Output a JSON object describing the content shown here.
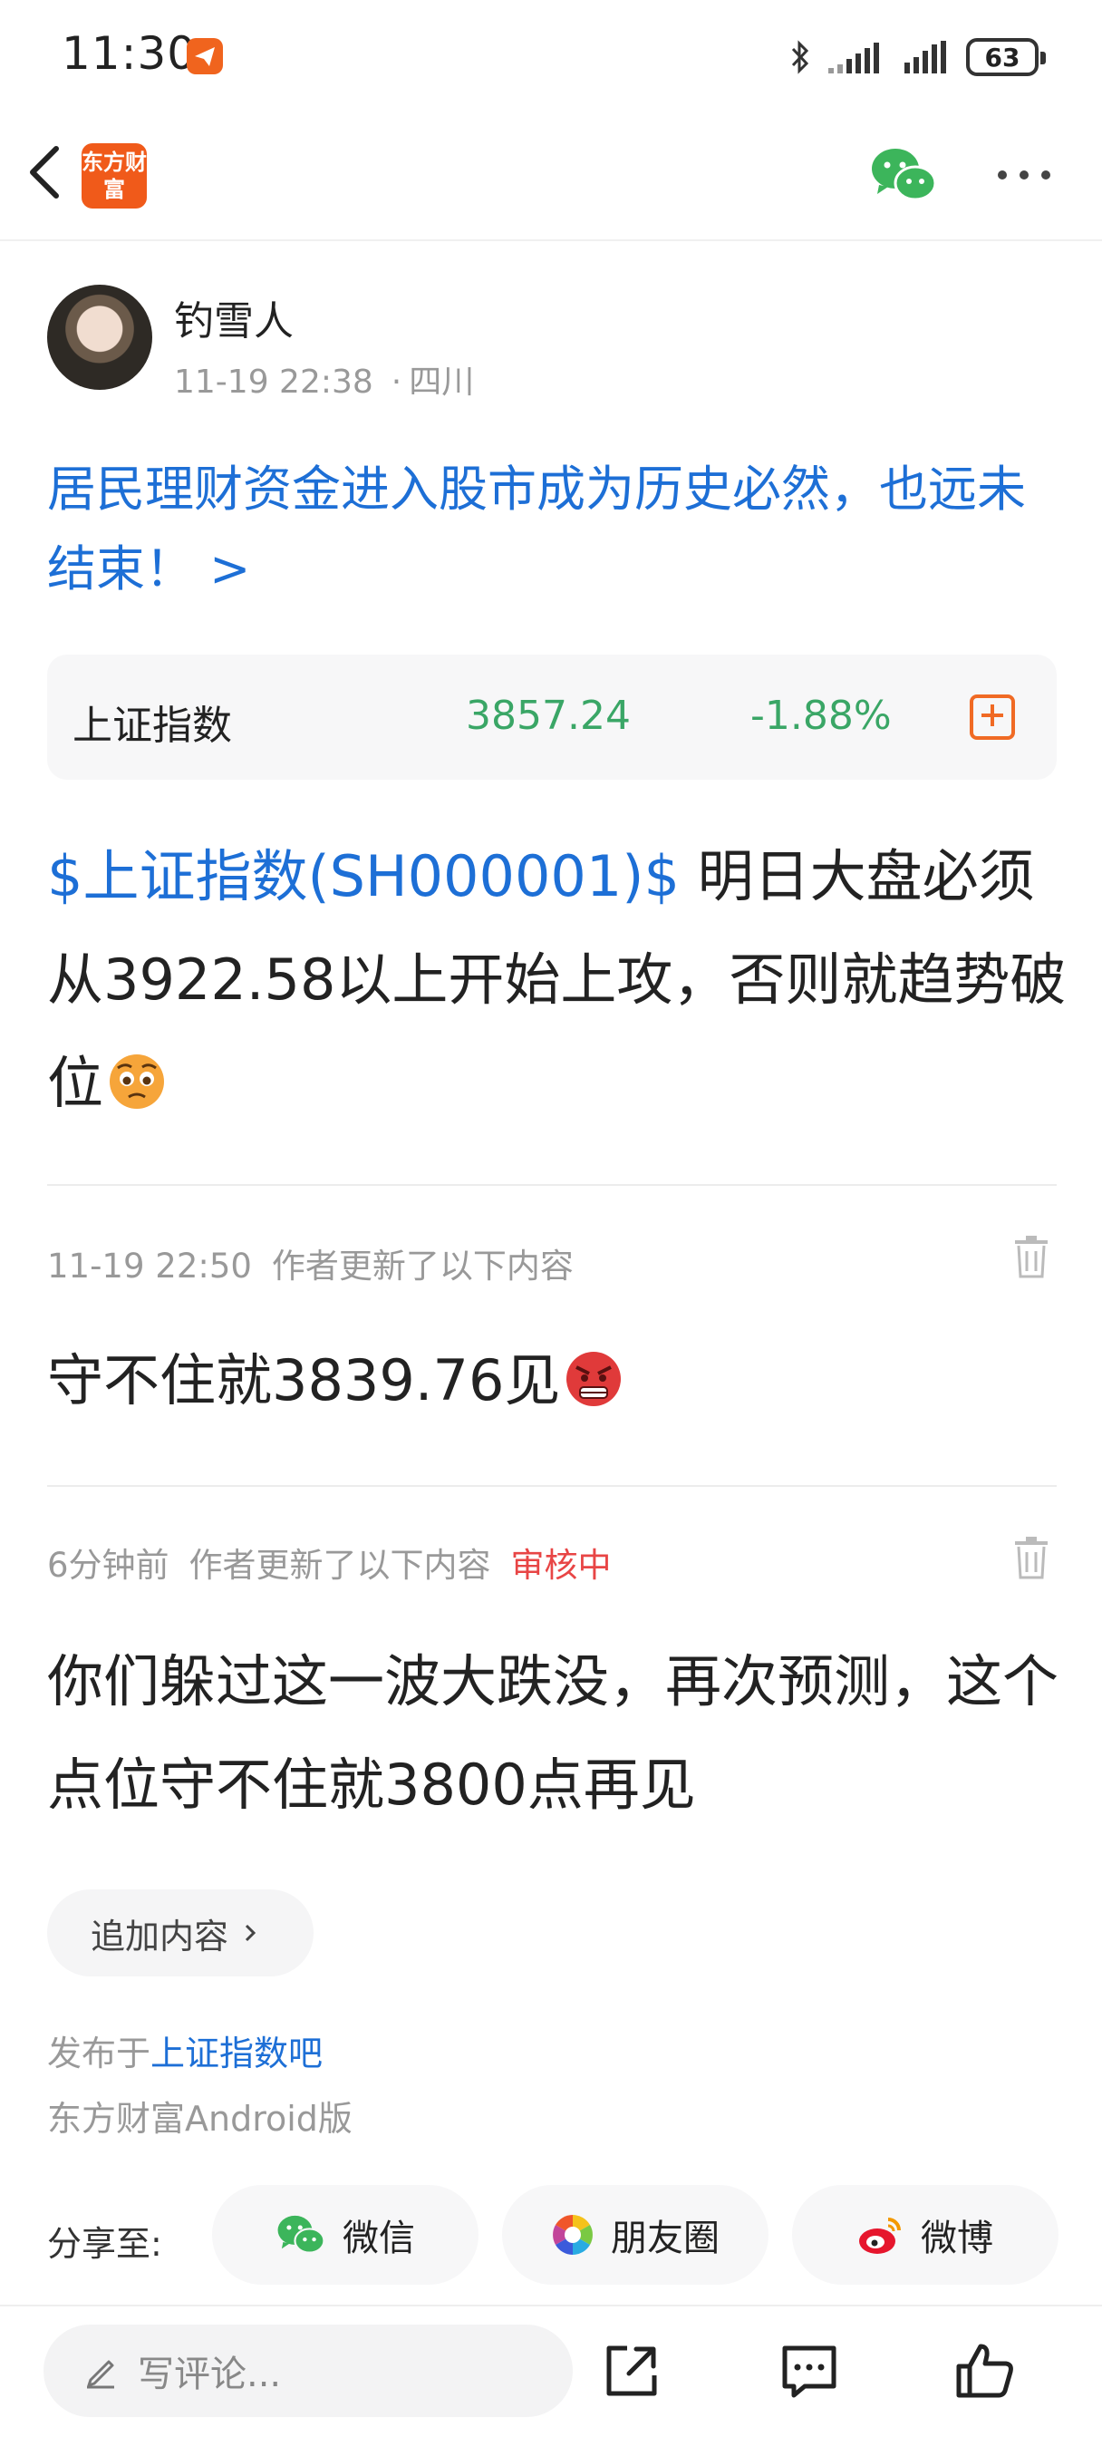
{
  "status_bar": {
    "time": "11:30",
    "battery": "63"
  },
  "app_bar": {
    "brand_logo_text": "东方财富"
  },
  "author": {
    "name": "钓雪人",
    "datetime": "11-19 22:38",
    "location": "四川",
    "separator": "·"
  },
  "post": {
    "title": "居民理财资金进入股市成为历史必然，也远未结束！ >",
    "quote": {
      "name": "上证指数",
      "price": "3857.24",
      "change": "-1.88%"
    },
    "stock_tag": "$上证指数(SH000001)$",
    "body": " 明日大盘必须从3922.58以上开始上攻，否则就趋势破位"
  },
  "updates": [
    {
      "time": "11-19 22:50",
      "label": "作者更新了以下内容",
      "status": "",
      "text": "守不住就3839.76见"
    },
    {
      "time": "6分钟前",
      "label": "作者更新了以下内容",
      "status": "审核中",
      "text": "你们躲过这一波大跌没，再次预测，这个点位守不住就3800点再见"
    }
  ],
  "append_button": "追加内容",
  "published": {
    "prefix": "发布于",
    "forum": "上证指数吧"
  },
  "platform": "东方财富Android版",
  "share": {
    "label": "分享至:",
    "wechat": "微信",
    "moments": "朋友圈",
    "weibo": "微博"
  },
  "bottom_bar": {
    "comment_placeholder": "写评论..."
  },
  "colors": {
    "link_blue": "#1d6fd6",
    "down_green": "#3aa666",
    "accent_orange": "#f06a24",
    "review_red": "#e84545"
  },
  "icons": [
    "back-arrow-icon",
    "wechat-icon",
    "more-icon",
    "add-watchlist-icon",
    "trash-icon",
    "pencil-icon",
    "share-out-icon",
    "comment-icon",
    "like-icon",
    "moments-icon",
    "weibo-icon"
  ]
}
